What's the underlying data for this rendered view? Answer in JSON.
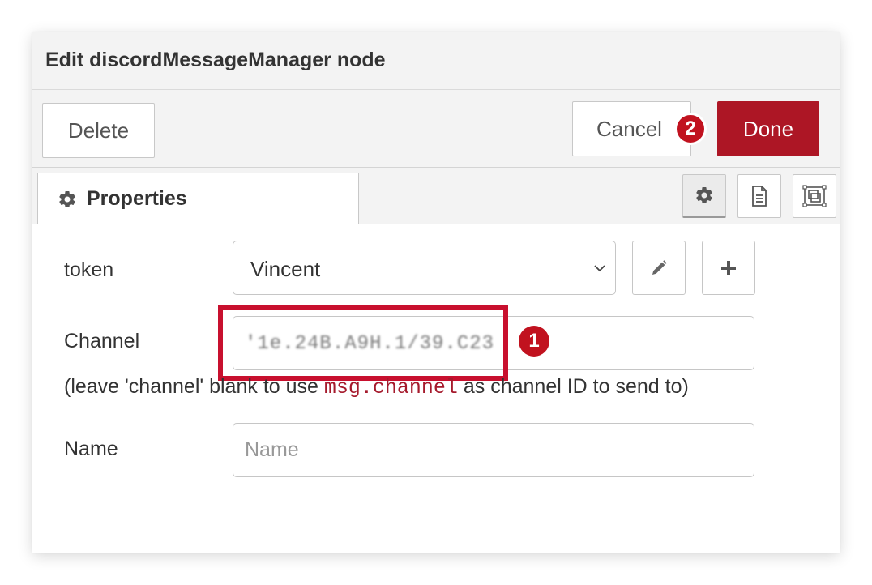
{
  "dialog": {
    "title": "Edit discordMessageManager node"
  },
  "toolbar": {
    "delete_label": "Delete",
    "cancel_label": "Cancel",
    "done_label": "Done",
    "done_color": "#ad1625"
  },
  "annotations": {
    "badge_1": "1",
    "badge_2": "2",
    "highlight_color": "#c8102e"
  },
  "tabs": {
    "properties_label": "Properties",
    "properties_icon": "gear-icon",
    "side_buttons": [
      "gear-icon",
      "document-icon",
      "frame-icon"
    ]
  },
  "form": {
    "token_label": "token",
    "token_value": "Vincent",
    "edit_icon": "pencil-icon",
    "add_icon": "plus-icon",
    "channel_label": "Channel",
    "channel_value": "'1e.24B.A9H.1/39.C23",
    "hint_prefix": "(leave 'channel' blank to use ",
    "hint_code": "msg.channel",
    "hint_suffix": " as channel ID to send to)",
    "name_label": "Name",
    "name_placeholder": "Name",
    "name_value": ""
  }
}
